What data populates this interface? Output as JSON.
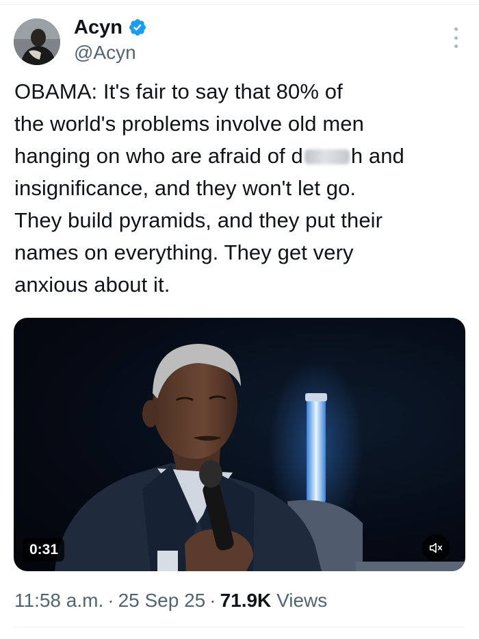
{
  "author": {
    "display_name": "Acyn",
    "handle": "@Acyn",
    "verified_icon": "verified-badge-icon",
    "avatar_icon": "avatar"
  },
  "tweet": {
    "lines": [
      "OBAMA: It's fair to say that 80% of",
      "the world's problems involve old men",
      "hanging on who are afraid of d",
      "h and",
      "insignificance, and they won't let go.",
      "They build pyramids, and they put their",
      "names on everything. They get very",
      "anxious about it."
    ]
  },
  "media": {
    "duration": "0:31",
    "mute_icon": "volume-muted-icon"
  },
  "meta": {
    "time": "11:58 a.m.",
    "separator": "·",
    "date": "25 Sep 25",
    "views_count": "71.9K",
    "views_label": "Views"
  },
  "colors": {
    "text": "#0f1419",
    "secondary": "#536471",
    "verified": "#1d9bf0",
    "divider": "#eff3f4"
  }
}
